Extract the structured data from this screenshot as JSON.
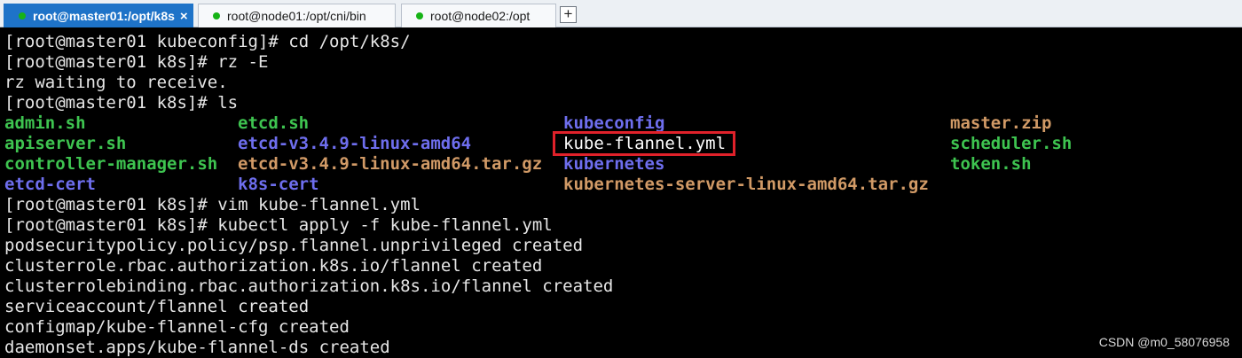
{
  "tabs": [
    {
      "label": "root@master01:/opt/k8s",
      "active": true,
      "close": "×"
    },
    {
      "label": "root@node01:/opt/cni/bin",
      "active": false
    },
    {
      "label": "root@node02:/opt",
      "active": false
    }
  ],
  "add_tab_label": "+",
  "colors": {
    "green": "#3ec450",
    "blue": "#6e6eee",
    "orange": "#d19a66",
    "white": "#ffffff",
    "highlight": "#e0212a",
    "tab_active": "#1e73c8",
    "status_dot": "#16b316"
  },
  "terminal": {
    "lines_before": [
      "[root@master01 kubeconfig]# cd /opt/k8s/",
      "[root@master01 k8s]# rz -E",
      "rz waiting to receive.",
      "[root@master01 k8s]# ls"
    ],
    "ls_rows": [
      [
        {
          "text": "admin.sh",
          "color": "green"
        },
        {
          "text": "etcd.sh",
          "color": "green"
        },
        {
          "text": "kubeconfig",
          "color": "blue"
        },
        {
          "text": "master.zip",
          "color": "orange"
        }
      ],
      [
        {
          "text": "apiserver.sh",
          "color": "green"
        },
        {
          "text": "etcd-v3.4.9-linux-amd64",
          "color": "blue"
        },
        {
          "text": "kube-flannel.yml",
          "color": "white"
        },
        {
          "text": "scheduler.sh",
          "color": "green"
        }
      ],
      [
        {
          "text": "controller-manager.sh",
          "color": "green"
        },
        {
          "text": "etcd-v3.4.9-linux-amd64.tar.gz",
          "color": "orange"
        },
        {
          "text": "kubernetes",
          "color": "blue"
        },
        {
          "text": "token.sh",
          "color": "green"
        }
      ],
      [
        {
          "text": "etcd-cert",
          "color": "blue"
        },
        {
          "text": "k8s-cert",
          "color": "blue"
        },
        {
          "text": "kubernetes-server-linux-amd64.tar.gz",
          "color": "orange"
        },
        {
          "text": "",
          "color": "white"
        }
      ]
    ],
    "lines_after": [
      "[root@master01 k8s]# vim kube-flannel.yml",
      "[root@master01 k8s]# kubectl apply -f kube-flannel.yml",
      "podsecuritypolicy.policy/psp.flannel.unprivileged created",
      "clusterrole.rbac.authorization.k8s.io/flannel created",
      "clusterrolebinding.rbac.authorization.k8s.io/flannel created",
      "serviceaccount/flannel created",
      "configmap/kube-flannel-cfg created",
      "daemonset.apps/kube-flannel-ds created"
    ]
  },
  "watermark": "CSDN @m0_58076958"
}
